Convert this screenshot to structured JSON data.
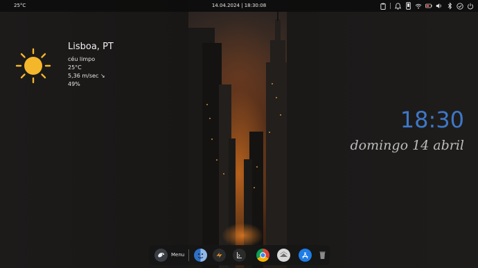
{
  "top_panel": {
    "temperature": "25°C",
    "datetime": "14.04.2024 | 18:30:08",
    "tray_icons": [
      "clipboard-icon",
      "notifications-icon",
      "phone-icon",
      "network-icon",
      "battery-icon",
      "volume-icon",
      "bluetooth-icon",
      "check-icon",
      "power-icon"
    ]
  },
  "weather": {
    "icon": "sun-icon",
    "city": "Lisboa, PT",
    "condition": "céu limpo",
    "temperature": "25°C",
    "wind": "5,36 m/sec ↘",
    "humidity": "49%"
  },
  "clock": {
    "time": "18:30",
    "date": "domingo 14 abril"
  },
  "dock": {
    "menu_label": "Menu",
    "apps": [
      "menu-logo-icon",
      "finder-icon",
      "scripting-icon",
      "terminal-icon",
      "chrome-icon",
      "mail-icon",
      "app-store-icon",
      "trash-icon"
    ]
  },
  "colors": {
    "clock_accent": "#3d78c8",
    "sun": "#f4b62b",
    "panel_bg": "#0e0e0e"
  }
}
